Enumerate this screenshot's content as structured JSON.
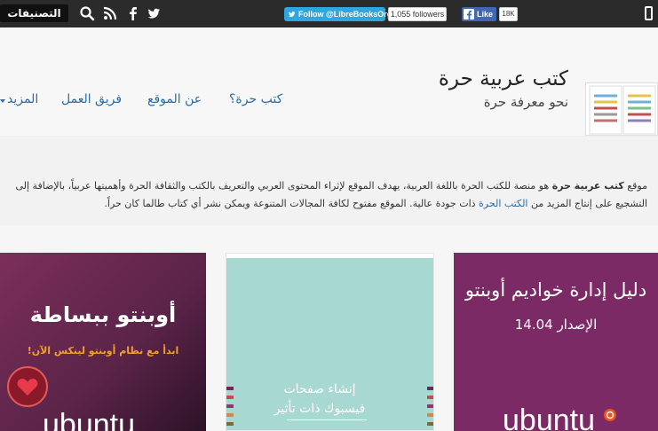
{
  "topbar": {
    "categories_label": "التصنيفات",
    "twitter_follow": "Follow @LibreBooksOrg",
    "twitter_followers": "1,055 followers",
    "facebook_like": "Like",
    "facebook_count": "18K"
  },
  "header": {
    "title": "كتب عربية حرة",
    "subtitle": "نحو معرفة حرة",
    "nav": {
      "free_books": "كتب حرة؟",
      "about": "عن الموقع",
      "team": "فريق العمل",
      "more": "المزيد"
    }
  },
  "intro": {
    "part1": "موقع ",
    "site_name": "كتب عربية حرة",
    "part2": " هو منصة للكتب الحرة باللغة العربية، يهدف الموقع لإثراء المحتوى العربي والتعريف بالكتب والثقافة الحرة وأهميتها عربياً، بالإضافة إلى التشجيع على إنتاج المزيد من ",
    "link_text": "الكتب الحرة",
    "part3": " ذات جودة عالية. الموقع مفتوح لكافة المجالات المتنوعة ويمكن نشر أي كتاب طالما كان حراً."
  },
  "books": [
    {
      "title": "دليل إدارة خواديم أوبنتو",
      "edition": "الإصدار 14.04",
      "brand": "ubuntu"
    },
    {
      "title_line1": "إنشاء صفحات",
      "title_line2": "فيسبوك ذات تأثير"
    },
    {
      "title": "أوبنتو ببساطة",
      "tagline": "ابدأ مع نظام أوبنتو لينكس الآن!",
      "brand": "ubuntu"
    }
  ],
  "icons": [
    "search-icon",
    "rss-icon",
    "facebook-icon",
    "twitter-icon",
    "mobile-menu-icon",
    "logo-books-icon",
    "heart-badge-icon"
  ],
  "colors": {
    "topbar": "#2b2b2b",
    "link": "#2a6ba8",
    "twitter": "#2ea7e0",
    "facebook": "#4267b2",
    "ubuntu_purple": "#7b2a66",
    "teal_cover": "#a7d9d2"
  }
}
